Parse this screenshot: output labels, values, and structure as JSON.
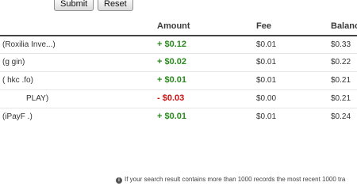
{
  "form": {
    "submit_label": "Submit",
    "reset_label": "Reset"
  },
  "table": {
    "columns": [
      "Amount",
      "Fee",
      "Balanc"
    ],
    "rows": [
      {
        "description": "(Roxilia Inve...)",
        "amount": "+ $0.12",
        "fee": "$0.01",
        "balance": "$0.33"
      },
      {
        "description": "(g          gin)",
        "amount": "+ $0.02",
        "fee": "$0.01",
        "balance": "$0.22"
      },
      {
        "description": "(       hkc    .fo)",
        "amount": "+ $0.01",
        "fee": "$0.01",
        "balance": "$0.21"
      },
      {
        "description": "PLAY)",
        "amount": "- $0.03",
        "fee": "$0.00",
        "balance": "$0.21"
      },
      {
        "description": "(iPayF    .)",
        "amount": "+ $0.01",
        "fee": "$0.01",
        "balance": "$0.24"
      }
    ]
  },
  "footer_note": "If your search result contains more than 1000 records the most recent 1000 tra",
  "colors": {
    "positive": "#2a8a1e",
    "negative": "#cc1111"
  },
  "icons": {
    "note": "info-icon"
  }
}
